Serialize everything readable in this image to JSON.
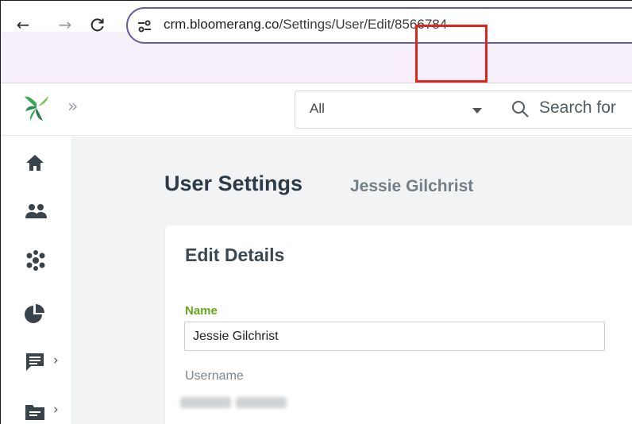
{
  "browser": {
    "url_host": "crm.bloomerang.co",
    "url_path": "/Settings/User/Edit/8566784"
  },
  "header": {
    "filter_value": "All",
    "search_placeholder": "Search for"
  },
  "sidebar": {
    "items": [
      {
        "icon": "home-icon"
      },
      {
        "icon": "people-icon"
      },
      {
        "icon": "groups-icon"
      },
      {
        "icon": "pie-chart-icon"
      },
      {
        "icon": "message-icon",
        "has_submenu": true
      },
      {
        "icon": "folder-icon",
        "has_submenu": true
      }
    ]
  },
  "page": {
    "title": "User Settings",
    "subtitle": "Jessie Gilchrist"
  },
  "card": {
    "title": "Edit Details",
    "name_label": "Name",
    "name_value": "Jessie Gilchrist",
    "username_label": "Username"
  },
  "colors": {
    "accent_green": "#6aa51e",
    "highlight_red": "#e0251b",
    "omnibox_border": "#6c5a9e"
  }
}
